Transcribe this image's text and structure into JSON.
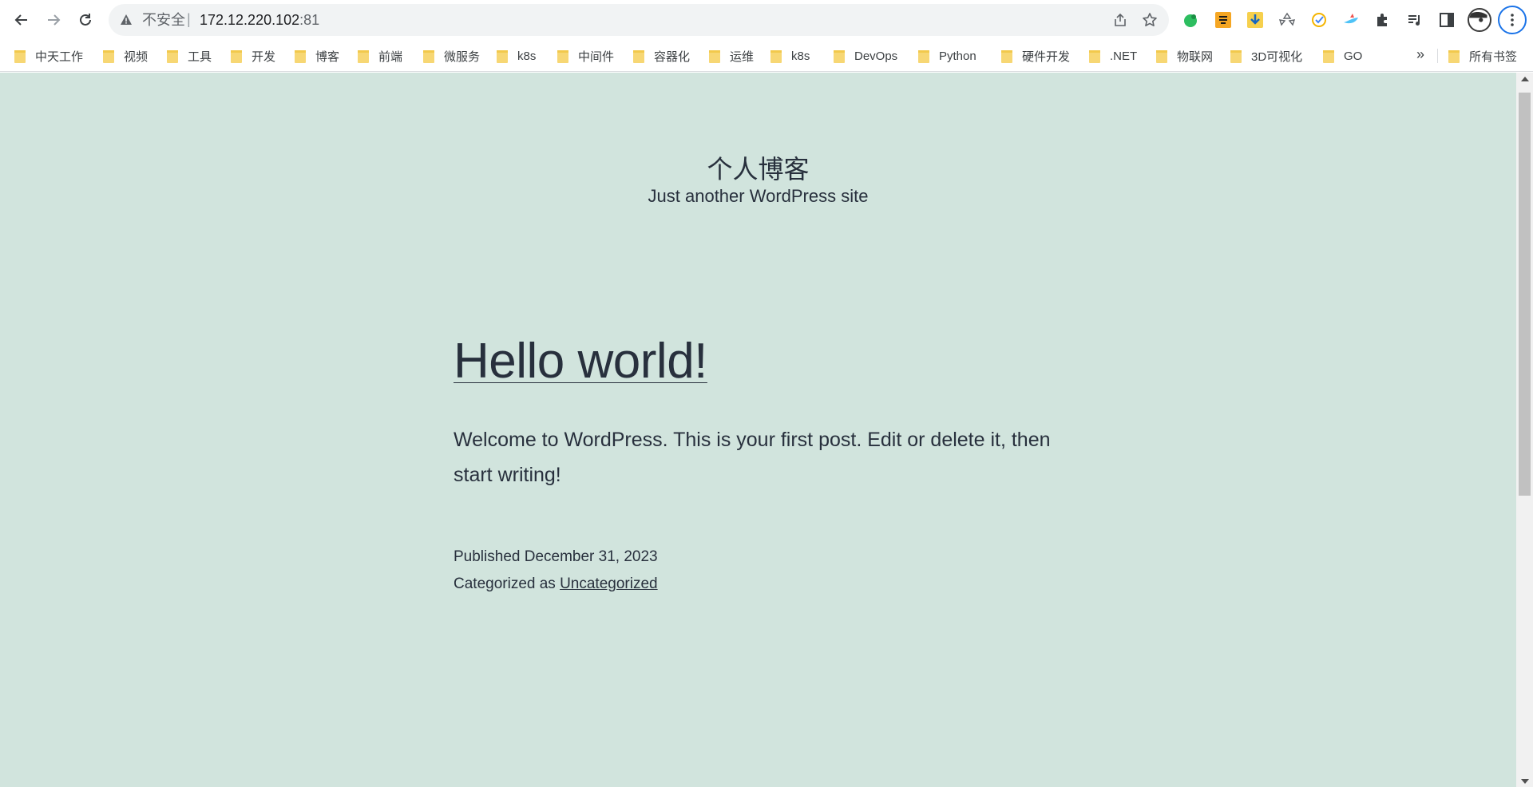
{
  "browser": {
    "security_label": "不安全",
    "separator": "|",
    "url_host": "172.12.220.102",
    "url_port": ":81"
  },
  "bookmarks": [
    {
      "label": "中天工作"
    },
    {
      "label": "视频"
    },
    {
      "label": "工具"
    },
    {
      "label": "开发"
    },
    {
      "label": "博客"
    },
    {
      "label": "前端"
    },
    {
      "label": "微服务"
    },
    {
      "label": "k8s"
    },
    {
      "label": "中间件"
    },
    {
      "label": "容器化"
    },
    {
      "label": "运维"
    },
    {
      "label": "k8s"
    },
    {
      "label": "DevOps"
    },
    {
      "label": "Python"
    },
    {
      "label": "硬件开发"
    },
    {
      "label": ".NET"
    },
    {
      "label": "物联网"
    },
    {
      "label": "3D可视化"
    },
    {
      "label": "GO"
    }
  ],
  "bookmarks_more": "»",
  "all_bookmarks": "所有书签",
  "extensions": [
    "evernote-icon",
    "ju-icon",
    "download-icon",
    "recycle-icon",
    "check-icon",
    "bird-icon",
    "puzzle-icon",
    "media-icon",
    "sidepanel-icon"
  ],
  "site": {
    "title": "个人博客",
    "description": "Just another WordPress site"
  },
  "post": {
    "title": "Hello world!",
    "body": "Welcome to WordPress. This is your first post. Edit or delete it, then start writing!",
    "published_label": "Published",
    "published_date": "December 31, 2023",
    "category_label": "Categorized as",
    "category": "Uncategorized"
  },
  "colors": {
    "page_background": "#d1e4dd",
    "text": "#28303d",
    "accent_blue": "#1a73e8"
  }
}
